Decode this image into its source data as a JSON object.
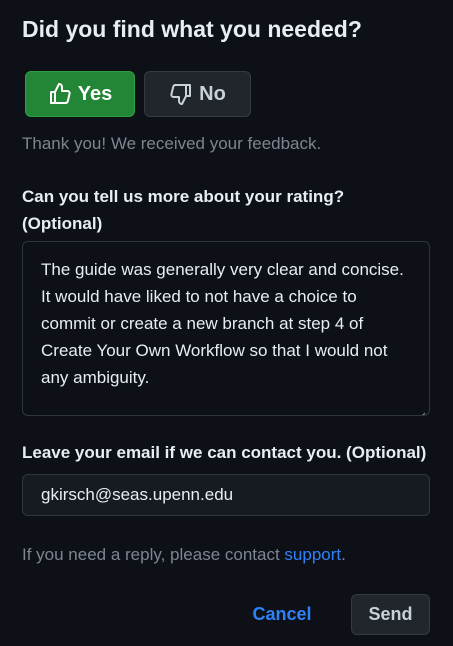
{
  "feedback": {
    "title": "Did you find what you needed?",
    "yes_label": "Yes",
    "no_label": "No",
    "selected": "Yes",
    "thanks_text": "Thank you! We received your feedback.",
    "rating_label_line1": "Can you tell us more about your rating?",
    "rating_label_line2": "(Optional)",
    "rating_comment": "The guide was generally very clear and concise. It would have liked to not have a choice to commit or create a new branch at step 4 of Create Your Own Workflow so that I would not any ambiguity.",
    "email_label": "Leave your email if we can contact you. (Optional)",
    "email_value": "gkirsch@seas.upenn.edu",
    "help_prefix": "If you need a reply, please contact ",
    "help_link": "support",
    "help_suffix": ".",
    "cancel_label": "Cancel",
    "send_label": "Send"
  },
  "colors": {
    "background": "#0d1117",
    "yes_button": "#238636",
    "link": "#2f81f7",
    "muted_text": "#7d8590"
  },
  "icons": {
    "yes": "thumbs-up-icon",
    "no": "thumbs-down-icon",
    "resize": "resize-handle-icon"
  }
}
